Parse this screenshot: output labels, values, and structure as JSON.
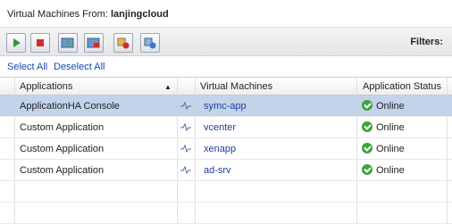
{
  "header": {
    "prefix": "Virtual Machines From:",
    "host": "lanjingcloud"
  },
  "toolbar": {
    "buttons": [
      "start",
      "stop",
      "enter-maintenance",
      "exit-maintenance",
      "disable",
      "enable"
    ],
    "filters_label": "Filters:"
  },
  "links": {
    "select_all": "Select All",
    "deselect_all": "Deselect All"
  },
  "table": {
    "headers": {
      "applications": "Applications",
      "sort": "▲",
      "vms": "Virtual Machines",
      "status": "Application Status"
    },
    "rows": [
      {
        "application": "ApplicationHA Console",
        "vm": "symc-app",
        "status": "Online"
      },
      {
        "application": "Custom Application",
        "vm": "vcenter",
        "status": "Online"
      },
      {
        "application": "Custom Application",
        "vm": "xenapp",
        "status": "Online"
      },
      {
        "application": "Custom Application",
        "vm": "ad-srv",
        "status": "Online"
      }
    ]
  },
  "colors": {
    "selected_row": "#c3d4ea",
    "link": "#1a47b0",
    "online": "#3ea33e"
  }
}
